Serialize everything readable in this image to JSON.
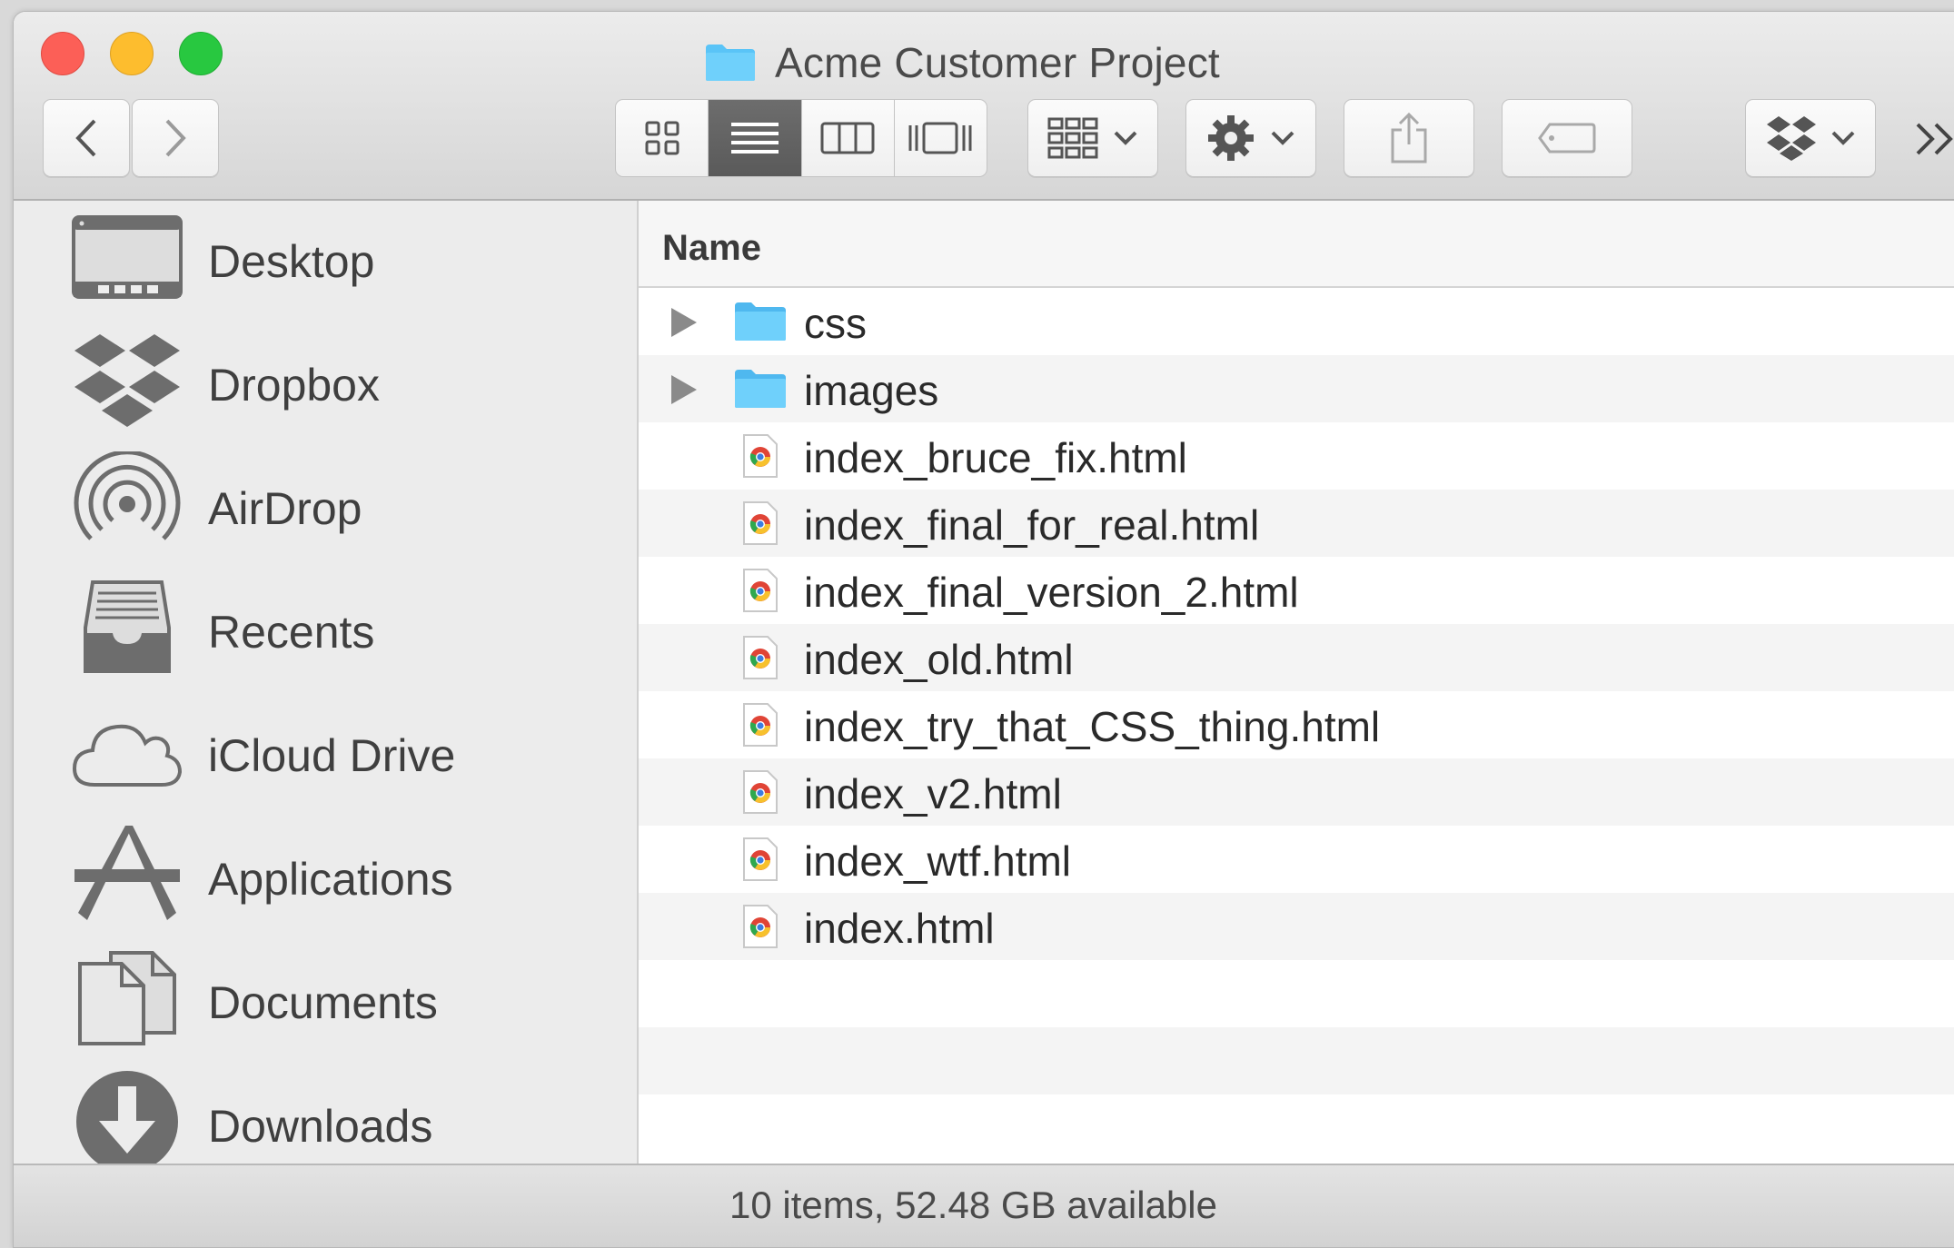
{
  "window": {
    "title": "Acme Customer Project"
  },
  "toolbar": {
    "view_modes": [
      "icon-view",
      "list-view",
      "column-view",
      "cover-flow-view"
    ],
    "active_view": "list-view",
    "buttons": [
      "arrange",
      "action",
      "share",
      "tags",
      "dropbox"
    ]
  },
  "sidebar": {
    "items": [
      {
        "label": "Desktop",
        "icon": "desktop-icon"
      },
      {
        "label": "Dropbox",
        "icon": "dropbox-icon"
      },
      {
        "label": "AirDrop",
        "icon": "airdrop-icon"
      },
      {
        "label": "Recents",
        "icon": "recents-icon"
      },
      {
        "label": "iCloud Drive",
        "icon": "cloud-icon"
      },
      {
        "label": "Applications",
        "icon": "applications-icon"
      },
      {
        "label": "Documents",
        "icon": "documents-icon"
      },
      {
        "label": "Downloads",
        "icon": "downloads-icon"
      }
    ]
  },
  "file_list": {
    "column_header": "Name",
    "rows": [
      {
        "name": "css",
        "type": "folder"
      },
      {
        "name": "images",
        "type": "folder"
      },
      {
        "name": "index_bruce_fix.html",
        "type": "html"
      },
      {
        "name": "index_final_for_real.html",
        "type": "html"
      },
      {
        "name": "index_final_version_2.html",
        "type": "html"
      },
      {
        "name": "index_old.html",
        "type": "html"
      },
      {
        "name": "index_try_that_CSS_thing.html",
        "type": "html"
      },
      {
        "name": "index_v2.html",
        "type": "html"
      },
      {
        "name": "index_wtf.html",
        "type": "html"
      },
      {
        "name": "index.html",
        "type": "html"
      }
    ]
  },
  "status_bar": {
    "text": "10 items, 52.48 GB available"
  },
  "colors": {
    "close": "#fc5f57",
    "minimize": "#fdbd2e",
    "maximize": "#28c840",
    "folder": "#5ac4f7",
    "sidebar_bg": "#ececec"
  }
}
